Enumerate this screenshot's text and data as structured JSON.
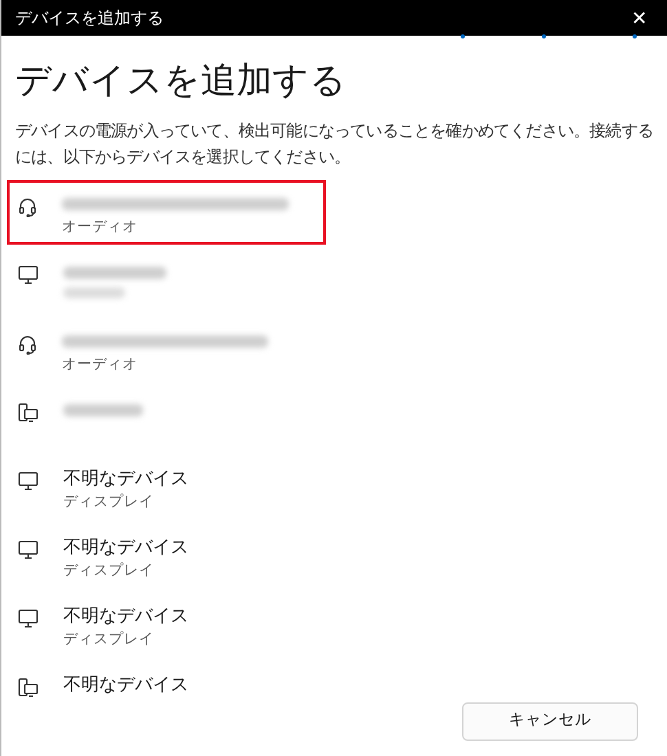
{
  "window": {
    "title": "デバイスを追加する",
    "close": "✕"
  },
  "heading": "デバイスを追加する",
  "description": "デバイスの電源が入っていて、検出可能になっていることを確かめてください。接続するには、以下からデバイスを選択してください。",
  "searching": true,
  "devices": [
    {
      "kind": "headset",
      "name_blurred": true,
      "subtitle": "オーディオ",
      "selected": true
    },
    {
      "kind": "monitor",
      "name_blurred": true,
      "subtitle_blurred": true,
      "selected": false
    },
    {
      "kind": "headset",
      "name_blurred": true,
      "subtitle": "オーディオ",
      "selected": false
    },
    {
      "kind": "phone",
      "name_blurred": true,
      "selected": false
    },
    {
      "kind": "monitor",
      "name": "不明なデバイス",
      "subtitle": "ディスプレイ",
      "selected": false
    },
    {
      "kind": "monitor",
      "name": "不明なデバイス",
      "subtitle": "ディスプレイ",
      "selected": false
    },
    {
      "kind": "monitor",
      "name": "不明なデバイス",
      "subtitle": "ディスプレイ",
      "selected": false
    },
    {
      "kind": "phone",
      "name": "不明なデバイス",
      "selected": false
    }
  ],
  "buttons": [
    {
      "label": "キャンセル"
    }
  ]
}
